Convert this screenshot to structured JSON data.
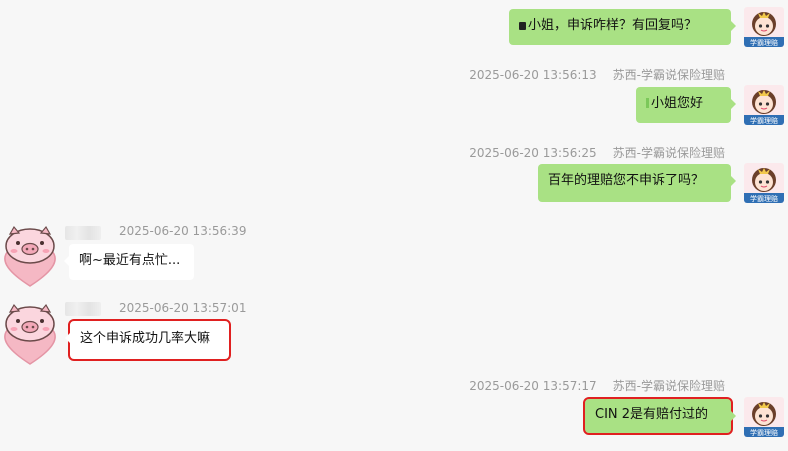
{
  "messages": [
    {
      "direction": "out",
      "text": "小姐，申诉咋样？有回复吗？",
      "time": "",
      "sender": ""
    },
    {
      "direction": "out",
      "text": "小姐您好",
      "time": "2025-06-20 13:56:13",
      "sender": "苏西-学霸说保险理赔"
    },
    {
      "direction": "out",
      "text": "百年的理赔您不申诉了吗？",
      "time": "2025-06-20 13:56:25",
      "sender": "苏西-学霸说保险理赔"
    },
    {
      "direction": "in",
      "text": "啊~最近有点忙...",
      "time": "2025-06-20 13:56:39",
      "sender": ""
    },
    {
      "direction": "in",
      "text": "这个申诉成功几率大嘛",
      "time": "2025-06-20 13:57:01",
      "sender": "",
      "highlighted": true
    },
    {
      "direction": "out",
      "text": "CIN 2是有赔付过的",
      "time": "2025-06-20 13:57:17",
      "sender": "苏西-学霸说保险理赔",
      "highlighted": true
    }
  ],
  "avatars": {
    "self_badge_text": "学霸理赔",
    "self_icon": "cartoon-girl-avatar-icon",
    "contact_icon": "pink-pig-heart-avatar-icon"
  },
  "colors": {
    "outgoing_bubble": "#a9e184",
    "incoming_bubble": "#ffffff",
    "highlight_border": "#e02020",
    "background": "#f7f7f7",
    "meta_text": "#9a9a9a"
  }
}
